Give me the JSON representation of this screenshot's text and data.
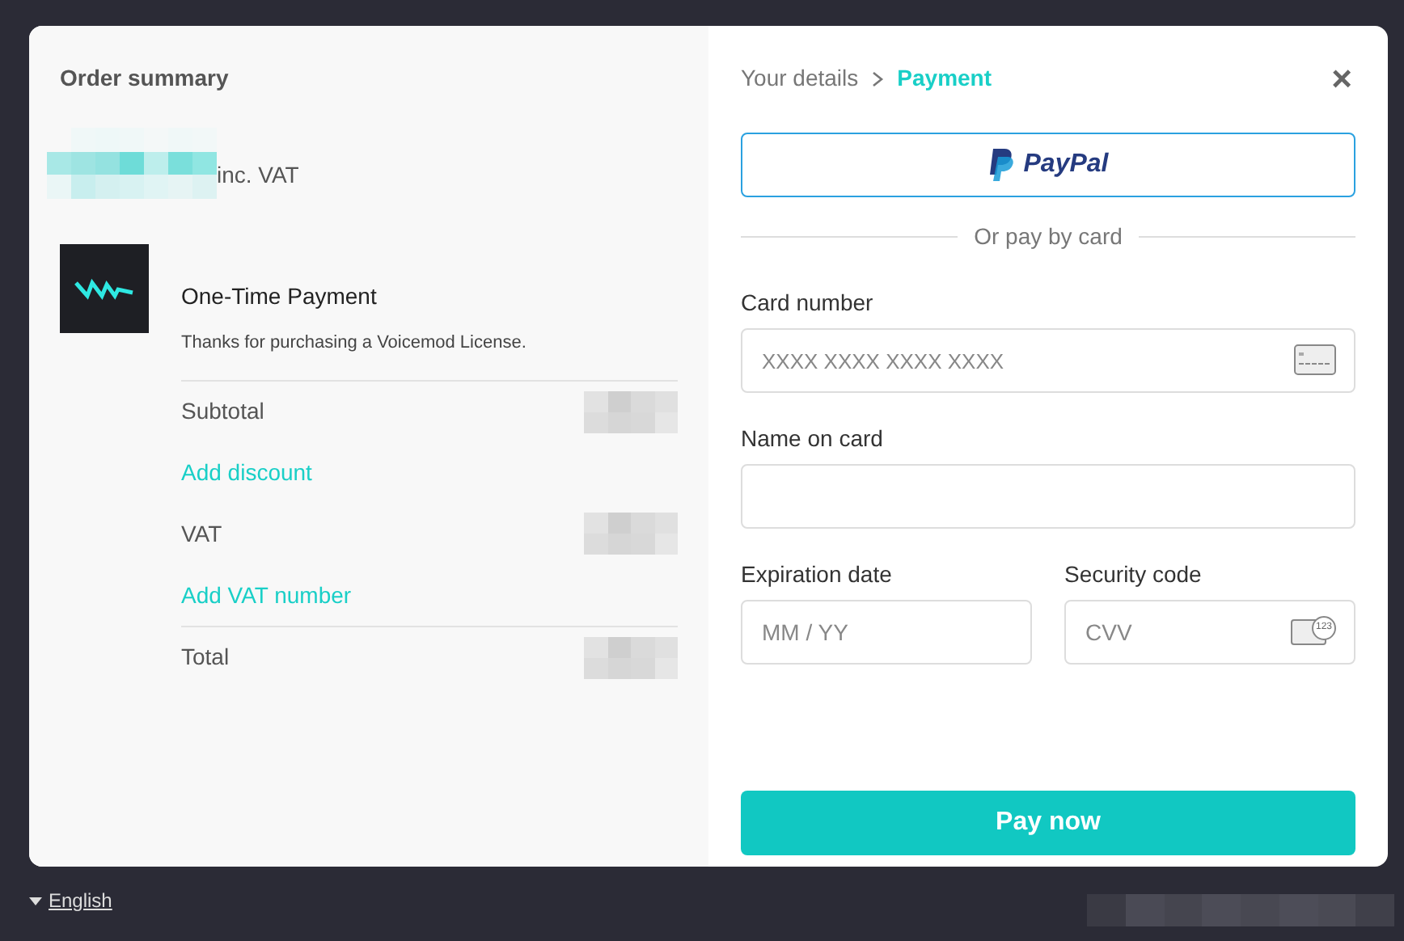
{
  "order_summary": {
    "title": "Order summary",
    "price_suffix": "inc. VAT",
    "product": {
      "name": "One-Time Payment",
      "description": "Thanks for purchasing a Voicemod License."
    },
    "lines": [
      {
        "kind": "amount",
        "label": "Subtotal"
      },
      {
        "kind": "link",
        "label": "Add discount"
      },
      {
        "kind": "amount",
        "label": "VAT"
      },
      {
        "kind": "link",
        "label": "Add VAT number"
      },
      {
        "kind": "amount",
        "label": "Total"
      }
    ]
  },
  "breadcrumb": [
    {
      "label": "Your details",
      "selected": false
    },
    {
      "label": "Payment",
      "selected": true
    }
  ],
  "close": "×",
  "paypal_button": {
    "label": "PayPal"
  },
  "divider": "Or pay by card",
  "fields": {
    "card_number": {
      "label": "Card number",
      "placeholder": "XXXX XXXX XXXX XXXX"
    },
    "name_on_card": {
      "label": "Name on card"
    },
    "expiration": {
      "label": "Expiration date",
      "placeholder": "MM / YY"
    },
    "security": {
      "label": "Security code",
      "placeholder": "CVV",
      "badge": "123"
    }
  },
  "pay_button": "Pay now",
  "language": "English"
}
